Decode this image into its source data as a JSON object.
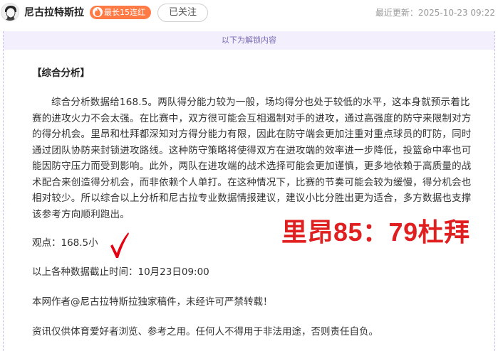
{
  "header": {
    "author_name": "尼古拉特斯拉",
    "streak_badge": "最长15连红",
    "follow_label": "已关注",
    "last_updated_label": "最近更新：",
    "last_updated_value": "2025-10-23 09:22"
  },
  "content": {
    "unlock_banner": "以下为解锁内容",
    "section_title": "【综合分析】",
    "analysis_text": "综合分析数据给168.5。两队得分能力较为一般，场均得分也处于较低的水平，这本身就预示着比赛的进攻火力不会太强。在比赛中，双方很可能会互相遏制对手的进攻，通过高强度的防守来限制对方的得分机会。里昂和杜拜都深知对方得分能力有限，因此在防守端会更加注重对重点球员的盯防，同时通过团队协防来封锁进攻路线。这种防守策略将使得双方在进攻端的效率进一步降低，投篮命中率也可能因防守压力而受到影响。此外，两队在进攻端的战术选择可能会更加谨慎，更多地依赖于高质量的战术配合来创造得分机会，而非依赖个人单打。在这种情况下，比赛的节奏可能会较为缓慢，得分机会也相对较少。所以综合以上分析和尼古拉专业数据情报建议，建议小比分胜出更为适合，多方数据也支撑该参考方向顺利跑出。",
    "viewpoint": "观点：168.5小",
    "score_overlay": "里昂85：79杜拜",
    "data_cutoff": "以上各种数据截止时间：10月23日09:00",
    "copyright": "本网作者@尼古拉特斯拉独家稿件，未经许可严禁转载！",
    "disclaimer": "资讯仅供体育爱好者浏览、参考之用。任何人不得用于非法用途，否则责任自负。"
  },
  "colors": {
    "badge_bg": "#ff7a45",
    "score_red": "#e02020",
    "banner_bg": "#f3effc",
    "banner_text": "#7d6bb8",
    "check_red": "#e60012"
  },
  "icons": {
    "avatar": "author-avatar",
    "badge": "fire-icon",
    "check": "checkmark-icon"
  }
}
